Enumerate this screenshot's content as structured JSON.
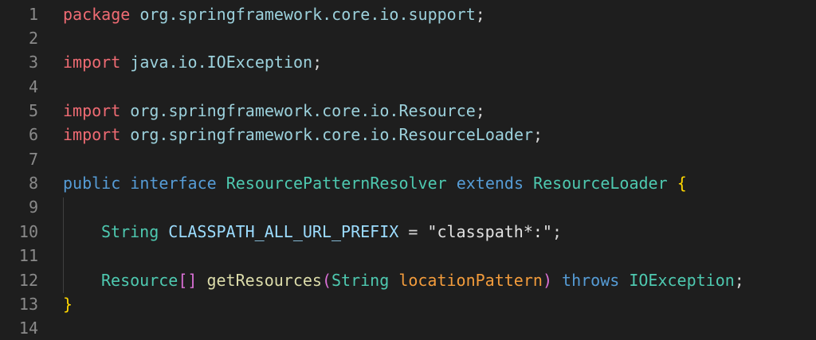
{
  "editor": {
    "line_numbers": [
      "1",
      "2",
      "3",
      "4",
      "5",
      "6",
      "7",
      "8",
      "9",
      "10",
      "11",
      "12",
      "13",
      "14"
    ],
    "line1": {
      "kw": "package",
      "pkg": "org.springframework.core.io.support",
      "end": ";"
    },
    "line3": {
      "kw": "import",
      "pkg": "java.io.IOException",
      "end": ";"
    },
    "line5": {
      "kw": "import",
      "pkg": "org.springframework.core.io.Resource",
      "end": ";"
    },
    "line6": {
      "kw": "import",
      "pkg": "org.springframework.core.io.ResourceLoader",
      "end": ";"
    },
    "line8": {
      "mod": "public",
      "kw": "interface",
      "name": "ResourcePatternResolver",
      "ext": "extends",
      "parent": "ResourceLoader",
      "brace": "{"
    },
    "line10": {
      "type": "String",
      "const": "CLASSPATH_ALL_URL_PREFIX",
      "eq": " = ",
      "value": "\"classpath*:\"",
      "end": ";"
    },
    "line12": {
      "type": "Resource",
      "brackets": "[]",
      "method": "getResources",
      "open": "(",
      "ptype": "String",
      "pname": "locationPattern",
      "close": ")",
      "throws": "throws",
      "exc": "IOException",
      "end": ";"
    },
    "line13": {
      "brace": "}"
    }
  },
  "colors": {
    "background": "#1e1e1e",
    "keyword_red": "#ef6b73",
    "keyword_blue": "#569cd6",
    "type": "#4ec9b0",
    "brace": "#ffd700",
    "paren": "#da70d6",
    "function": "#dcdcaa",
    "parameter": "#f39c3c"
  }
}
